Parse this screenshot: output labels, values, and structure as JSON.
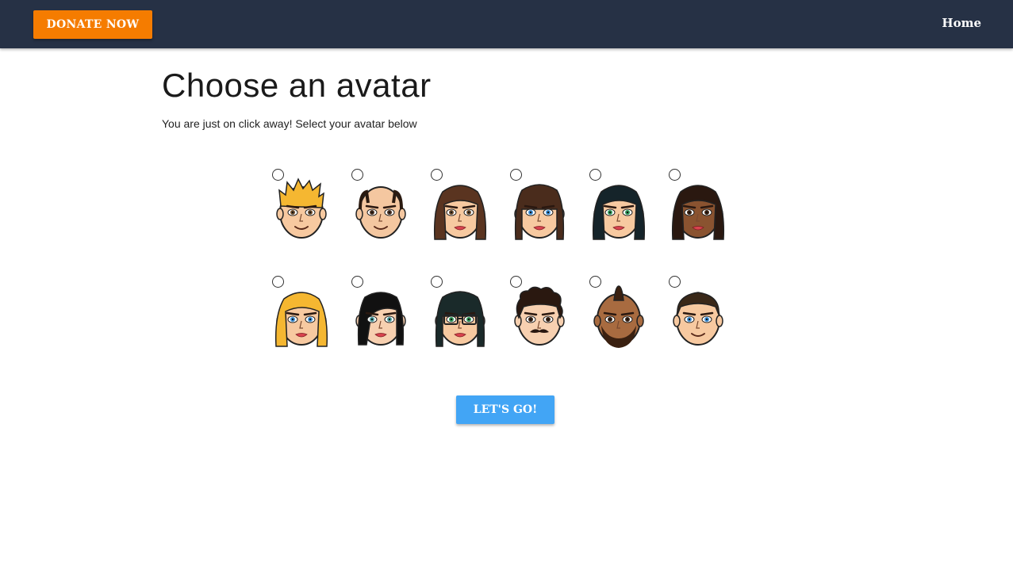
{
  "navbar": {
    "donate_label": "DONATE NOW",
    "home_label": "Home",
    "background_color": "#263145",
    "donate_color": "#f57c00"
  },
  "main": {
    "title": "Choose an avatar",
    "subtitle": "You are just on click away! Select your avatar below"
  },
  "avatars": [
    {
      "name": "blond-spiky-man",
      "hair": "#f5b731",
      "skin": "#f7c9a0",
      "style": "spiky",
      "eyes": "#6b4a2a",
      "extra": "none"
    },
    {
      "name": "bald-man",
      "hair": "#2a1a10",
      "skin": "#f4c7a0",
      "style": "bald",
      "eyes": "#4a3020",
      "extra": "none"
    },
    {
      "name": "brown-haired-woman",
      "hair": "#5a3420",
      "skin": "#f7c9a0",
      "style": "long",
      "eyes": "#6b4a2a",
      "extra": "none"
    },
    {
      "name": "bangs-woman",
      "hair": "#4a2c1c",
      "skin": "#f7c9a0",
      "style": "bangs",
      "eyes": "#3b8fd8",
      "extra": "none"
    },
    {
      "name": "black-haired-woman",
      "hair": "#15242a",
      "skin": "#f7c9a0",
      "style": "long",
      "eyes": "#2e9a5a",
      "extra": "none"
    },
    {
      "name": "dark-skinned-woman",
      "hair": "#2a1810",
      "skin": "#8a5330",
      "style": "long",
      "eyes": "#3a2010",
      "extra": "none"
    },
    {
      "name": "blonde-woman",
      "hair": "#f5b731",
      "skin": "#f7c9a0",
      "style": "long",
      "eyes": "#3b8fd8",
      "extra": "none"
    },
    {
      "name": "black-bob-woman",
      "hair": "#111111",
      "skin": "#f7d0b0",
      "style": "bob",
      "eyes": "#4aa0a0",
      "extra": "none"
    },
    {
      "name": "glasses-woman",
      "hair": "#1a2a2a",
      "skin": "#f7c9a0",
      "style": "bangs",
      "eyes": "#2e9a5a",
      "extra": "glasses"
    },
    {
      "name": "mustache-man",
      "hair": "#2a1810",
      "skin": "#f7d0b0",
      "style": "curly",
      "eyes": "#3a2010",
      "extra": "mustache"
    },
    {
      "name": "mohawk-man",
      "hair": "#3a2010",
      "skin": "#a86b40",
      "style": "mohawk",
      "eyes": "#3a2010",
      "extra": "beard"
    },
    {
      "name": "blue-eyed-man",
      "hair": "#3a2818",
      "skin": "#f7c9a0",
      "style": "short",
      "eyes": "#3b8fd8",
      "extra": "none"
    }
  ],
  "actions": {
    "go_label": "LET'S GO!",
    "go_color": "#42a5f5"
  }
}
